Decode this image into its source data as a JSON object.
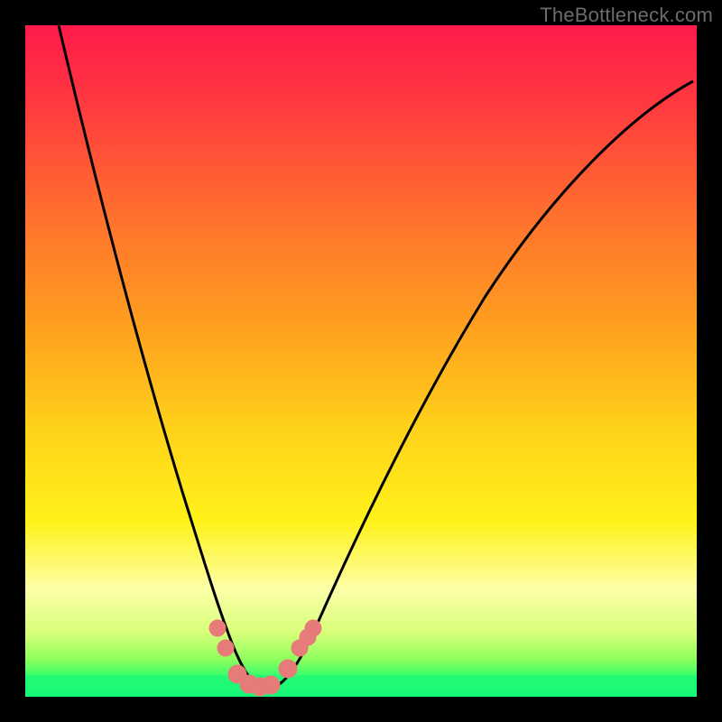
{
  "watermark": "TheBottleneck.com",
  "colors": {
    "frame": "#000000",
    "curve": "#000000",
    "dots": "#e77b79",
    "greenBand": "#23f97c",
    "gradientStops": [
      {
        "offset": 0.0,
        "color": "#ff1a4b"
      },
      {
        "offset": 0.12,
        "color": "#ff3a3f"
      },
      {
        "offset": 0.28,
        "color": "#ff6f2e"
      },
      {
        "offset": 0.45,
        "color": "#ffa01f"
      },
      {
        "offset": 0.6,
        "color": "#ffd21a"
      },
      {
        "offset": 0.74,
        "color": "#fff21a"
      },
      {
        "offset": 0.84,
        "color": "#fdffa8"
      },
      {
        "offset": 0.905,
        "color": "#d7ff7a"
      },
      {
        "offset": 0.945,
        "color": "#8cff5c"
      },
      {
        "offset": 0.97,
        "color": "#34ff6e"
      },
      {
        "offset": 1.0,
        "color": "#11f87a"
      }
    ]
  },
  "chart_data": {
    "type": "line",
    "title": "",
    "xlabel": "",
    "ylabel": "",
    "xlim": [
      0,
      100
    ],
    "ylim": [
      0,
      100
    ],
    "note": "Axes are unlabeled in the source image; x is a normalized horizontal position and y the curve height as a fraction of the plot area (0 = bottom, 100 = top).",
    "series": [
      {
        "name": "bottleneck-curve",
        "x": [
          5,
          8,
          12,
          16,
          20,
          24,
          27,
          29,
          31,
          33,
          35,
          38,
          42,
          47,
          53,
          60,
          68,
          76,
          84,
          92,
          99
        ],
        "y": [
          100,
          88,
          72,
          56,
          41,
          27,
          17,
          10,
          5,
          2,
          1,
          2,
          5,
          12,
          23,
          36,
          50,
          62,
          72,
          80,
          86
        ]
      }
    ],
    "highlight_points": {
      "name": "pink-dots-near-minimum",
      "x": [
        28.5,
        29.7,
        31.5,
        33.0,
        34.5,
        36.2,
        38.8,
        40.6,
        41.8,
        42.6
      ],
      "y": [
        10.0,
        7.0,
        3.0,
        2.0,
        1.8,
        2.0,
        4.5,
        7.5,
        9.0,
        10.5
      ]
    },
    "green_band_y_range": [
      0,
      6
    ]
  }
}
